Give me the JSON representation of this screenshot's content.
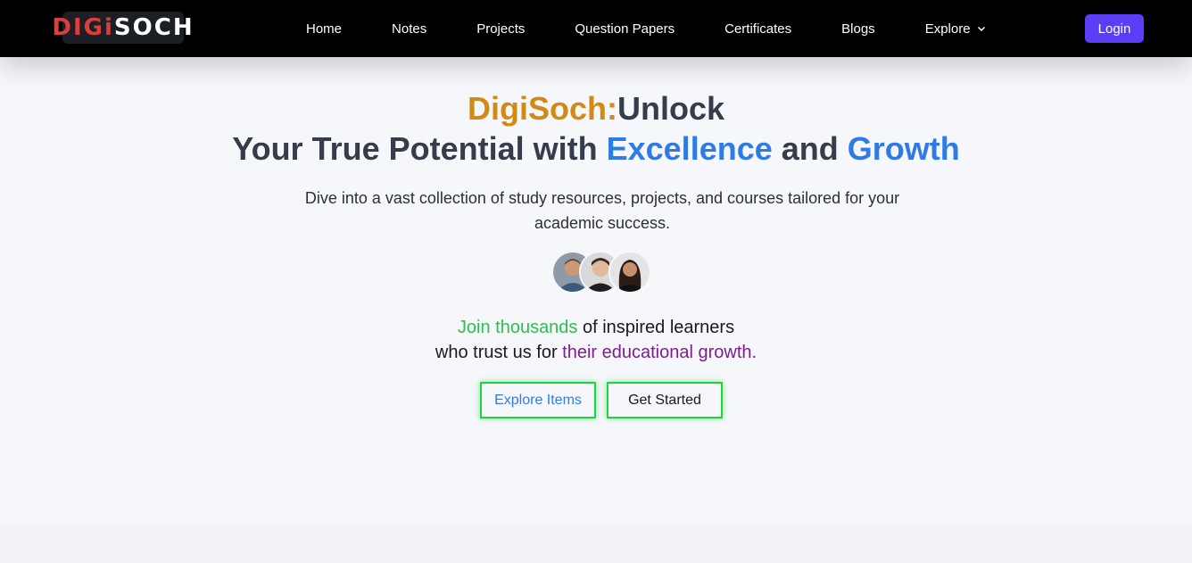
{
  "brand": {
    "logo_part_a": "DIGi",
    "logo_part_b": "SOCH"
  },
  "nav": {
    "items": [
      "Home",
      "Notes",
      "Projects",
      "Question Papers",
      "Certificates",
      "Blogs",
      "Explore"
    ],
    "login_label": "Login"
  },
  "hero": {
    "headline_brand": "DigiSoch:",
    "headline_rest_1": "Unlock",
    "headline_line2_a": "Your True Potential with ",
    "headline_line2_b": "Excellence",
    "headline_line2_c": " and ",
    "headline_line2_d": "Growth",
    "subtitle": "Dive into a vast collection of study resources, projects, and courses tailored for your academic success.",
    "join_green": "Join thousands",
    "join_rest": " of inspired learners",
    "trust_a": "who trust us for ",
    "trust_purple": "their educational growth.",
    "btn_explore": "Explore Items",
    "btn_start": "Get Started"
  },
  "colors": {
    "navbar": "#000000",
    "login": "#5b3df5",
    "brand_orange": "#d08a15",
    "accent_blue": "#2f7be6",
    "green": "#2dbf4e",
    "purple": "#7b1f8e",
    "button_border": "#1fd43a"
  },
  "icons": {
    "explore_chevron": "chevron-down-icon"
  }
}
